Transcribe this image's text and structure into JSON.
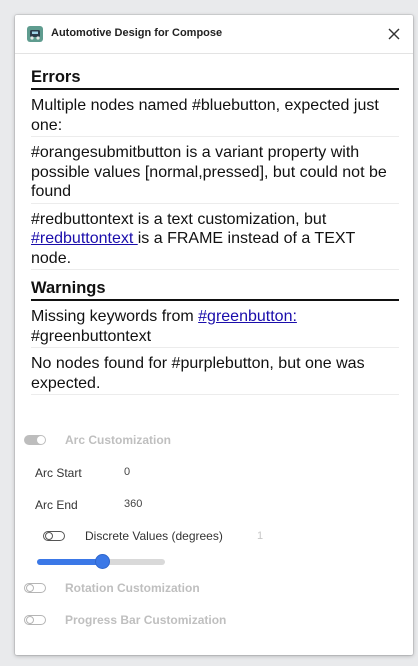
{
  "window": {
    "title": "Automotive Design for Compose",
    "icon": "app-icon",
    "close_icon": "close-icon"
  },
  "errors": {
    "heading": "Errors",
    "items": [
      "Multiple nodes named #bluebutton, expected just one:",
      "#orangesubmitbutton is a variant property with possible values [normal,pressed], but could not be found"
    ],
    "item3": {
      "prefix": "#redbuttontext is a text customization, but ",
      "link": "#redbuttontext ",
      "suffix": "is a FRAME instead of a TEXT node."
    }
  },
  "warnings": {
    "heading": "Warnings",
    "item1": {
      "prefix": "Missing keywords from ",
      "link": "#greenbutton:",
      "suffix": " #greenbuttontext"
    },
    "item2": "No nodes found for #purplebutton, but one was expected."
  },
  "customizations": {
    "arc": {
      "label": "Arc Customization",
      "enabled": true,
      "start_label": "Arc Start",
      "start_value": "0",
      "end_label": "Arc End",
      "end_value": "360",
      "discrete_label": "Discrete Values (degrees)",
      "discrete_value": "1",
      "discrete_enabled": false,
      "slider_fraction": 0.51
    },
    "rotation": {
      "label": "Rotation Customization",
      "enabled": false
    },
    "progress": {
      "label": "Progress Bar Customization",
      "enabled": false
    }
  },
  "colors": {
    "accent": "#3b78e7",
    "link": "#1a0dab"
  }
}
